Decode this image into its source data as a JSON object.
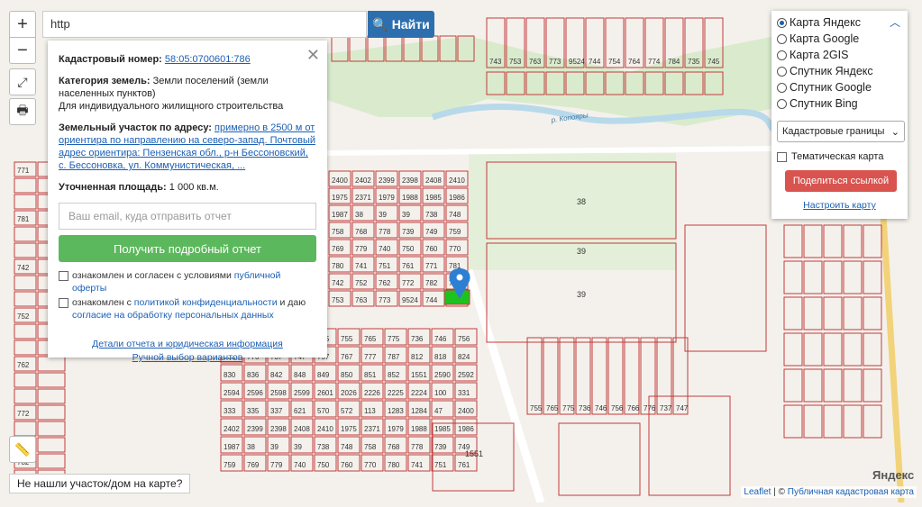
{
  "search": {
    "value": "http",
    "button": "Найти"
  },
  "zoom": {
    "in": "+",
    "out": "−"
  },
  "popup": {
    "cad_label": "Кадастровый номер:",
    "cad_value": "58:05:0700601:786",
    "cat_label": "Категория земель:",
    "cat_value": "Земли поселений (земли населенных пунктов)",
    "usage": "Для индивидуального жилищного строительства",
    "addr_label": "Земельный участок по адресу:",
    "addr_value": "примерно в 2500 м от ориентира по направлению на северо-запад. Почтовый адрес ориентира: Пензенская обл., р-н Бессоновский, с. Бессоновка, ул. Коммунистическая, ...",
    "area_label": "Уточненная площадь:",
    "area_value": "1 000 кв.м.",
    "email_placeholder": "Ваш email, куда отправить отчет",
    "get_report": "Получить подробный отчет",
    "agree1_pre": "ознакомлен и согласен с условиями ",
    "agree1_link": "публичной оферты",
    "agree2_pre": "ознакомлен с ",
    "agree2_link": "политикой конфиденциальности",
    "agree2_mid": " и даю ",
    "agree2_link2": "согласие на обработку персональных данных",
    "details_link": "Детали отчета и юридическая информация",
    "manual_link": "Ручной выбор вариантов"
  },
  "layers": {
    "options": [
      "Карта Яндекс",
      "Карта Google",
      "Карта 2GIS",
      "Спутник Яндекс",
      "Спутник Google",
      "Спутник Bing"
    ],
    "selected": 0,
    "select_value": "Кадастровые границы",
    "thematic": "Тематическая карта",
    "share": "Поделиться ссылкой",
    "setup": "Настроить карту"
  },
  "not_found": "Не нашли участок/дом на карте?",
  "attribution": {
    "leaflet": "Leaflet",
    "sep": " | © ",
    "pkk": "Публичная кадастровая карта"
  },
  "yandex_logo": "Яндекс",
  "map_labels": {
    "river": "р. Копояры",
    "parcels": [
      "2400",
      "2402",
      "2399",
      "2398",
      "2408",
      "2410",
      "1975",
      "2371",
      "1979",
      "1988",
      "1985",
      "1986",
      "1987",
      "38",
      "39",
      "39",
      "738",
      "748",
      "758",
      "768",
      "778",
      "739",
      "749",
      "759",
      "769",
      "779",
      "740",
      "750",
      "760",
      "770",
      "780",
      "741",
      "751",
      "761",
      "771",
      "781",
      "742",
      "752",
      "762",
      "772",
      "782",
      "743",
      "753",
      "763",
      "773",
      "9524",
      "744",
      "754",
      "764",
      "774",
      "784",
      "735",
      "745",
      "755",
      "765",
      "775",
      "736",
      "746",
      "756",
      "766",
      "776",
      "737",
      "747",
      "757",
      "767",
      "777",
      "787",
      "812",
      "818",
      "824",
      "830",
      "836",
      "842",
      "848",
      "849",
      "850",
      "851",
      "852",
      "1551",
      "2590",
      "2592",
      "2594",
      "2596",
      "2598",
      "2599",
      "2601",
      "2026",
      "2226",
      "2225",
      "2224",
      "100",
      "331",
      "333",
      "335",
      "337",
      "621",
      "570",
      "572",
      "113",
      "1283",
      "1284",
      "47"
    ]
  },
  "colors": {
    "parcel": "#c23b3b",
    "road": "#ffffff",
    "river": "#b8d9ea",
    "green": "#cfe6c0",
    "highlight": "#1ec21e",
    "marker": "#2d7fd3"
  }
}
